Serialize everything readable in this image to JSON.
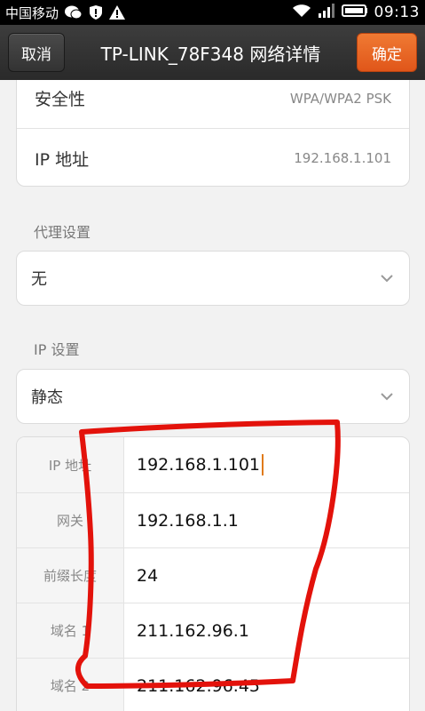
{
  "status_bar": {
    "carrier": "中国移动",
    "time": "09:13"
  },
  "header": {
    "cancel_label": "取消",
    "title": "TP-LINK_78F348 网络详情",
    "confirm_label": "确定"
  },
  "network_info": [
    {
      "label": "安全性",
      "value": "WPA/WPA2 PSK"
    },
    {
      "label": "IP 地址",
      "value": "192.168.1.101"
    }
  ],
  "proxy": {
    "section_label": "代理设置",
    "selected": "无"
  },
  "ip_settings": {
    "section_label": "IP 设置",
    "selected": "静态",
    "fields": [
      {
        "label": "IP 地址",
        "value": "192.168.1.101"
      },
      {
        "label": "网关",
        "value": "192.168.1.1"
      },
      {
        "label": "前缀长度",
        "value": "24"
      },
      {
        "label": "域名 1",
        "value": "211.162.96.1"
      },
      {
        "label": "域名 2",
        "value": "211.162.96.45"
      }
    ]
  },
  "colors": {
    "accent_orange": "#e8651f",
    "annotation_red": "#e3120b"
  }
}
